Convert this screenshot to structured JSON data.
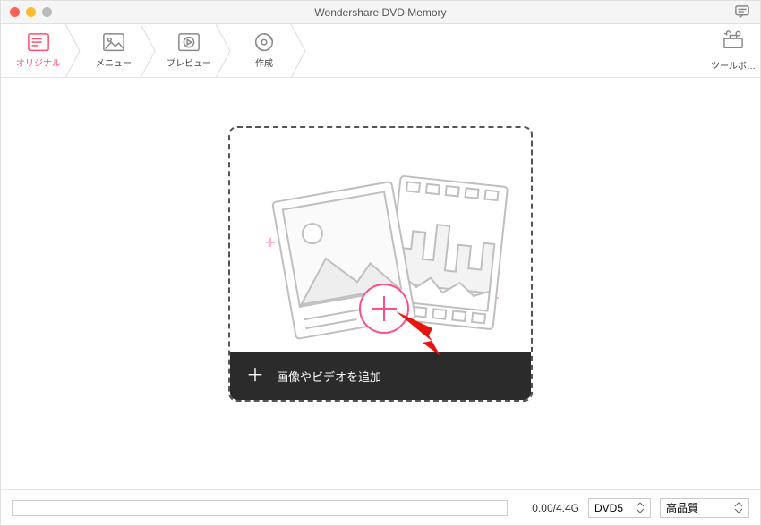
{
  "window": {
    "title": "Wondershare DVD Memory"
  },
  "steps": {
    "original": "オリジナル",
    "menu": "メニュー",
    "preview": "プレビュー",
    "create": "作成"
  },
  "toolbox": {
    "label": "ツールボ…"
  },
  "drop": {
    "add_label": "画像やビデオを追加"
  },
  "bottom": {
    "size": "0.00/4.4G",
    "disc": "DVD5",
    "quality": "高品質"
  }
}
